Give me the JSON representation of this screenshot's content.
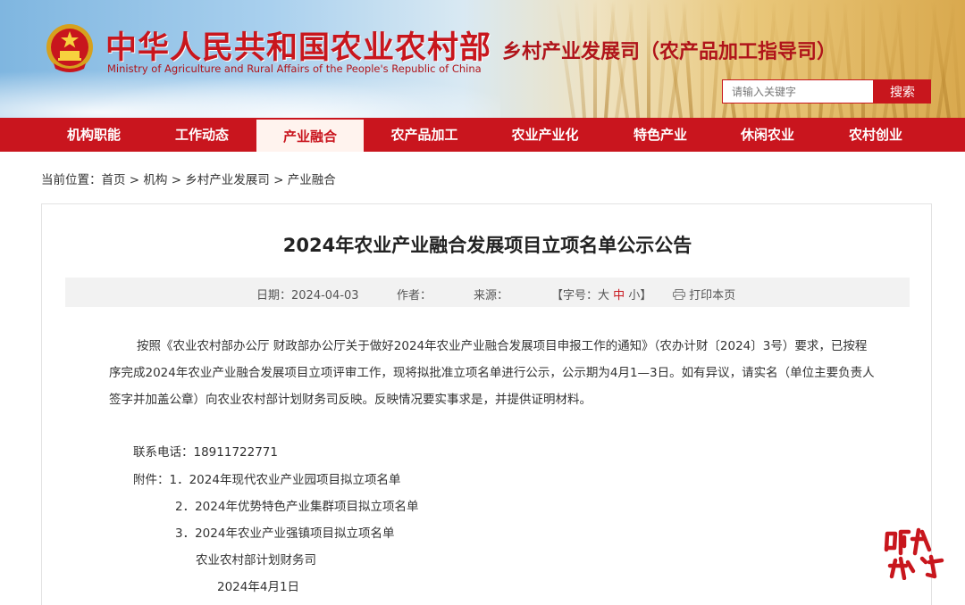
{
  "header": {
    "ministry_cn": "中华人民共和国农业农村部",
    "ministry_en": "Ministry of Agriculture and Rural Affairs of the People's Republic of China",
    "department": "乡村产业发展司（农产品加工指导司）",
    "search_placeholder": "请输入关键字",
    "search_button": "搜索"
  },
  "nav": {
    "items": [
      {
        "label": "机构职能",
        "active": false
      },
      {
        "label": "工作动态",
        "active": false
      },
      {
        "label": "产业融合",
        "active": true
      },
      {
        "label": "农产品加工",
        "active": false
      },
      {
        "label": "农业产业化",
        "active": false
      },
      {
        "label": "特色产业",
        "active": false
      },
      {
        "label": "休闲农业",
        "active": false
      },
      {
        "label": "农村创业",
        "active": false
      }
    ]
  },
  "breadcrumb": {
    "prefix": "当前位置：",
    "items": [
      "首页",
      "机构",
      "乡村产业发展司",
      "产业融合"
    ],
    "separator": " > "
  },
  "article": {
    "title": "2024年农业产业融合发展项目立项名单公示公告",
    "meta": {
      "date_label": "日期：",
      "date": "2024-04-03",
      "author_label": "作者：",
      "source_label": "来源：",
      "font_open": "【字号：",
      "font_large": "大",
      "font_medium": "中",
      "font_small": "小",
      "font_close": "】",
      "print_label": "打印本页"
    },
    "body_lines": [
      "按照《农业农村部办公厅 财政部办公厅关于做好2024年农业产业融合发展项目申报工作的通知》（农办计财〔2024〕3号）要求，已按程",
      "序完成2024年农业产业融合发展项目立项评审工作，现将拟批准立项名单进行公示，公示期为4月1—3日。如有异议，请实名（单位主要负责人",
      "签字并加盖公章）向农业农村部计划财务司反映。反映情况要实事求是，并提供证明材料。"
    ],
    "contact": "联系电话：18911722771",
    "attachments": [
      "附件：1．2024年现代农业产业园项目拟立项名单",
      "2．2024年优势特色产业集群项目拟立项名单",
      "3．2024年农业产业强镇项目拟立项名单"
    ],
    "signer": "农业农村部计划财务司",
    "sign_date": "2024年4月1日"
  },
  "colors": {
    "brand_red": "#c9151e",
    "active_tab_bg": "#fff3ee",
    "meta_bg": "#f2f2f2"
  }
}
